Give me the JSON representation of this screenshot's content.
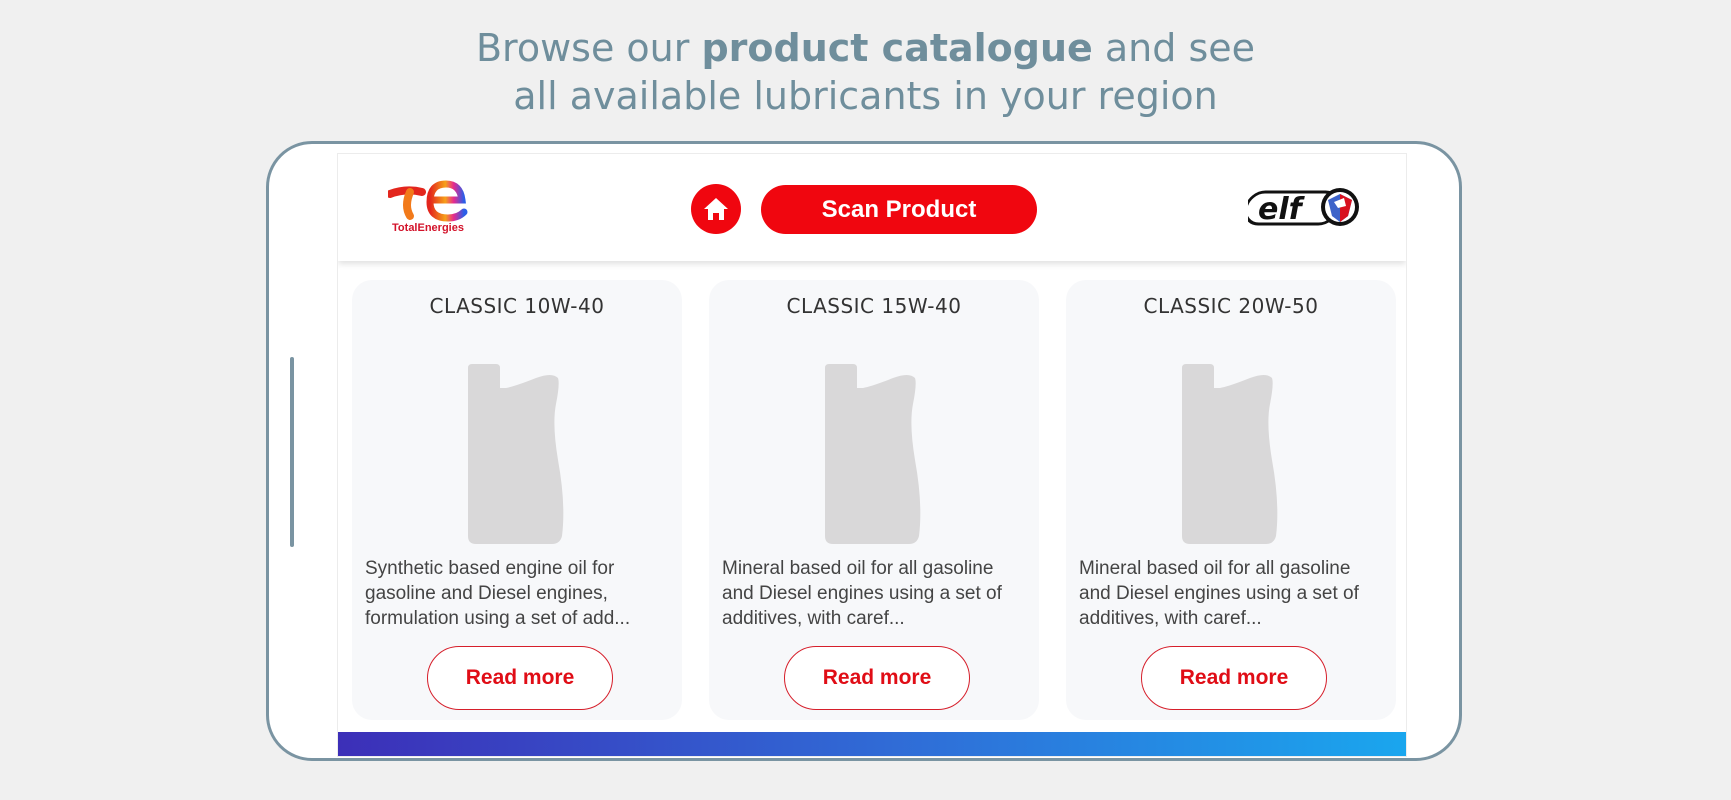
{
  "headline": {
    "line1_prefix": "Browse our ",
    "line1_bold": "product catalogue",
    "line1_suffix": " and see",
    "line2": "all available lubricants in your region"
  },
  "header": {
    "brand_logo_text": "TotalEnergies",
    "scan_button_label": "Scan Product",
    "home_icon": "home-icon",
    "partner_logo_text": "elf"
  },
  "products": [
    {
      "name": "CLASSIC 10W-40",
      "description": "Synthetic based engine oil for gasoline and Diesel engines, formulation using a set of add...",
      "button_label": "Read more"
    },
    {
      "name": "CLASSIC 15W-40",
      "description": "Mineral based oil for all gasoline and Diesel engines using a set of additives, with caref...",
      "button_label": "Read more"
    },
    {
      "name": "CLASSIC 20W-50",
      "description": "Mineral based oil for all gasoline and Diesel engines using a set of additives, with caref...",
      "button_label": "Read more"
    }
  ],
  "colors": {
    "accent_red": "#f0060f",
    "headline": "#6f8e9c",
    "frame": "#7a94a2",
    "card_bg": "#f7f8fa",
    "bottle": "#d9d8d9"
  }
}
